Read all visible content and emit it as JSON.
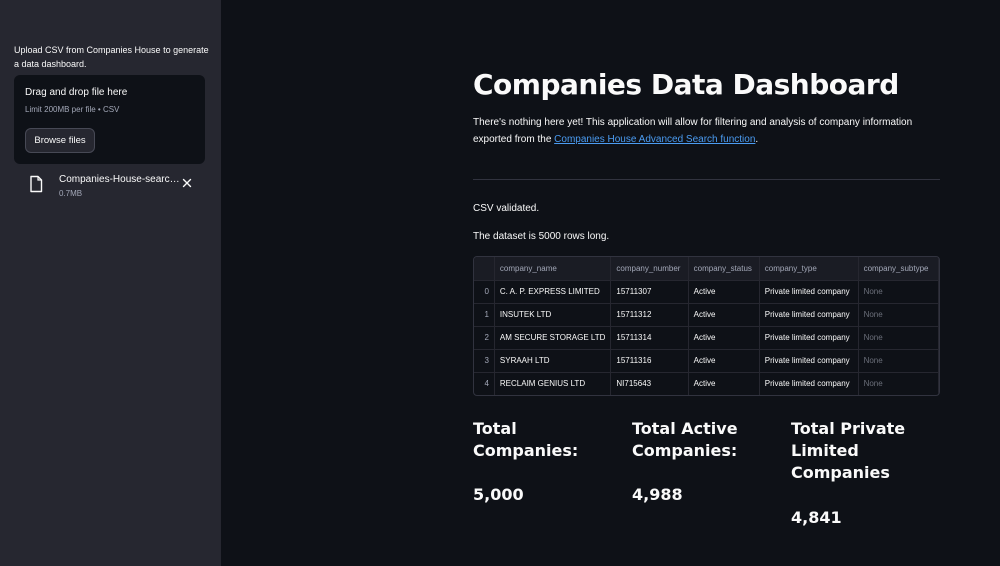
{
  "sidebar": {
    "intro": "Upload CSV from Companies House to generate a data dashboard.",
    "dropzone": {
      "title": "Drag and drop file here",
      "limit": "Limit 200MB per file • CSV",
      "browse_label": "Browse files"
    },
    "uploaded_file": {
      "name": "Companies-House-search-results.csv",
      "size": "0.7MB",
      "icon": "file-icon"
    }
  },
  "main": {
    "title": "Companies Data Dashboard",
    "intro_text": "There's nothing here yet! This application will allow for filtering and analysis of company information exported from the ",
    "intro_link": "Companies House Advanced Search function",
    "intro_end": ".",
    "csv_status": "CSV validated.",
    "rows_text": "The dataset is 5000 rows long.",
    "table": {
      "columns": [
        "",
        "company_name",
        "company_number",
        "company_status",
        "company_type",
        "company_subtype"
      ],
      "rows": [
        [
          "0",
          "C. A. P. EXPRESS LIMITED",
          "15711307",
          "Active",
          "Private limited company",
          "None"
        ],
        [
          "1",
          "INSUTEK LTD",
          "15711312",
          "Active",
          "Private limited company",
          "None"
        ],
        [
          "2",
          "AM SECURE STORAGE LTD",
          "15711314",
          "Active",
          "Private limited company",
          "None"
        ],
        [
          "3",
          "SYRAAH LTD",
          "15711316",
          "Active",
          "Private limited company",
          "None"
        ],
        [
          "4",
          "RECLAIM GENIUS LTD",
          "NI715643",
          "Active",
          "Private limited company",
          "None"
        ]
      ]
    },
    "metrics": [
      {
        "label": "Total Companies:",
        "value": "5,000"
      },
      {
        "label": "Total Active Companies:",
        "value": "4,988"
      },
      {
        "label": "Total Private Limited Companies",
        "value": "4,841"
      }
    ]
  },
  "colors": {
    "background": "#0e1117",
    "sidebar": "#262730",
    "link": "#4b9cf2",
    "text": "#fafafa",
    "muted": "#a3a8b8"
  }
}
